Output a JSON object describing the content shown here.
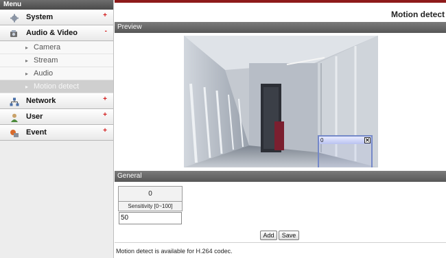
{
  "sidebar": {
    "header": "Menu",
    "items": [
      {
        "label": "System",
        "mark": "+",
        "icon": "gear-icon"
      },
      {
        "label": "Audio & Video",
        "mark": "-",
        "icon": "camera-icon",
        "children": [
          {
            "label": "Camera"
          },
          {
            "label": "Stream"
          },
          {
            "label": "Audio"
          },
          {
            "label": "Motion detect",
            "active": true
          }
        ]
      },
      {
        "label": "Network",
        "mark": "+",
        "icon": "network-icon"
      },
      {
        "label": "User",
        "mark": "+",
        "icon": "user-icon"
      },
      {
        "label": "Event",
        "mark": "+",
        "icon": "event-icon"
      }
    ]
  },
  "main": {
    "title": "Motion detect",
    "preview_section": "Preview",
    "roi": {
      "label": "0",
      "close": "✕"
    },
    "general_section": "General",
    "region": {
      "id": "0",
      "sensitivity_label": "Sensitivity [0~100]",
      "sensitivity_value": "50"
    },
    "buttons": {
      "add": "Add",
      "save": "Save"
    },
    "note": "Motion detect is available for H.264 codec."
  },
  "colors": {
    "accent": "#8e1a1a",
    "section_bar": "#6a6a6a",
    "roi_border": "#7488c8",
    "mark": "#d21919"
  }
}
